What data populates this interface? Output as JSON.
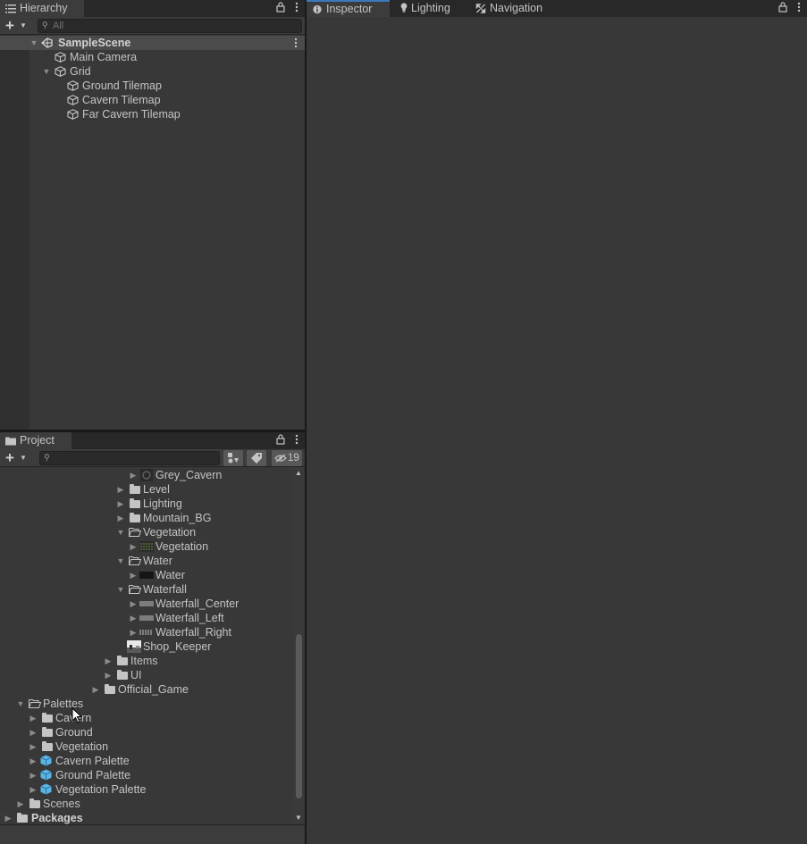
{
  "hierarchy": {
    "tab_label": "Hierarchy",
    "search_placeholder": "All",
    "items": [
      {
        "label": "SampleScene",
        "bold": true,
        "expanded": true,
        "icon": "unity-scene-icon"
      },
      {
        "label": "Main Camera",
        "icon": "gameobject-cube-icon"
      },
      {
        "label": "Grid",
        "expanded": true,
        "icon": "gameobject-cube-icon"
      },
      {
        "label": "Ground Tilemap",
        "icon": "gameobject-cube-icon"
      },
      {
        "label": "Cavern Tilemap",
        "icon": "gameobject-cube-icon"
      },
      {
        "label": "Far Cavern Tilemap",
        "icon": "gameobject-cube-icon"
      }
    ]
  },
  "inspector": {
    "tabs": [
      {
        "label": "Inspector",
        "icon": "info-icon",
        "active": true
      },
      {
        "label": "Lighting",
        "icon": "lightbulb-icon"
      },
      {
        "label": "Navigation",
        "icon": "navigation-icon"
      }
    ]
  },
  "project": {
    "tab_label": "Project",
    "search_placeholder": "",
    "hidden_count": "19",
    "items": [
      {
        "label": "Grey_Cavern",
        "icon": "tileset-thumbnail-icon"
      },
      {
        "label": "Level",
        "icon": "folder-icon"
      },
      {
        "label": "Lighting",
        "icon": "folder-icon"
      },
      {
        "label": "Mountain_BG",
        "icon": "folder-icon"
      },
      {
        "label": "Vegetation",
        "icon": "folder-open-icon"
      },
      {
        "label": "Vegetation",
        "icon": "vegetation-sprite-icon"
      },
      {
        "label": "Water",
        "icon": "folder-open-icon"
      },
      {
        "label": "Water",
        "icon": "water-sprite-icon"
      },
      {
        "label": "Waterfall",
        "icon": "folder-open-icon"
      },
      {
        "label": "Waterfall_Center",
        "icon": "waterfall-sprite-icon"
      },
      {
        "label": "Waterfall_Left",
        "icon": "waterfall-sprite-icon"
      },
      {
        "label": "Waterfall_Right",
        "icon": "waterfall-sprite-icon"
      },
      {
        "label": "Shop_Keeper",
        "icon": "shopkeeper-sprite-icon"
      },
      {
        "label": "Items",
        "icon": "folder-icon"
      },
      {
        "label": "UI",
        "icon": "folder-icon"
      },
      {
        "label": "Official_Game",
        "icon": "folder-icon"
      },
      {
        "label": "Palettes",
        "icon": "folder-open-icon"
      },
      {
        "label": "Cavern",
        "icon": "folder-icon"
      },
      {
        "label": "Ground",
        "icon": "folder-icon"
      },
      {
        "label": "Vegetation",
        "icon": "folder-icon"
      },
      {
        "label": "Cavern Palette",
        "icon": "prefab-cube-icon"
      },
      {
        "label": "Ground Palette",
        "icon": "prefab-cube-icon"
      },
      {
        "label": "Vegetation Palette",
        "icon": "prefab-cube-icon"
      },
      {
        "label": "Scenes",
        "icon": "folder-icon"
      },
      {
        "label": "Packages",
        "icon": "folder-icon",
        "bold": true
      }
    ]
  },
  "colors": {
    "panel_bg": "#383838",
    "tab_bar_bg": "#282828",
    "active_tab_accent": "#3a79bb",
    "prefab_blue": "#5ab4e6",
    "text": "#c4c4c4"
  }
}
